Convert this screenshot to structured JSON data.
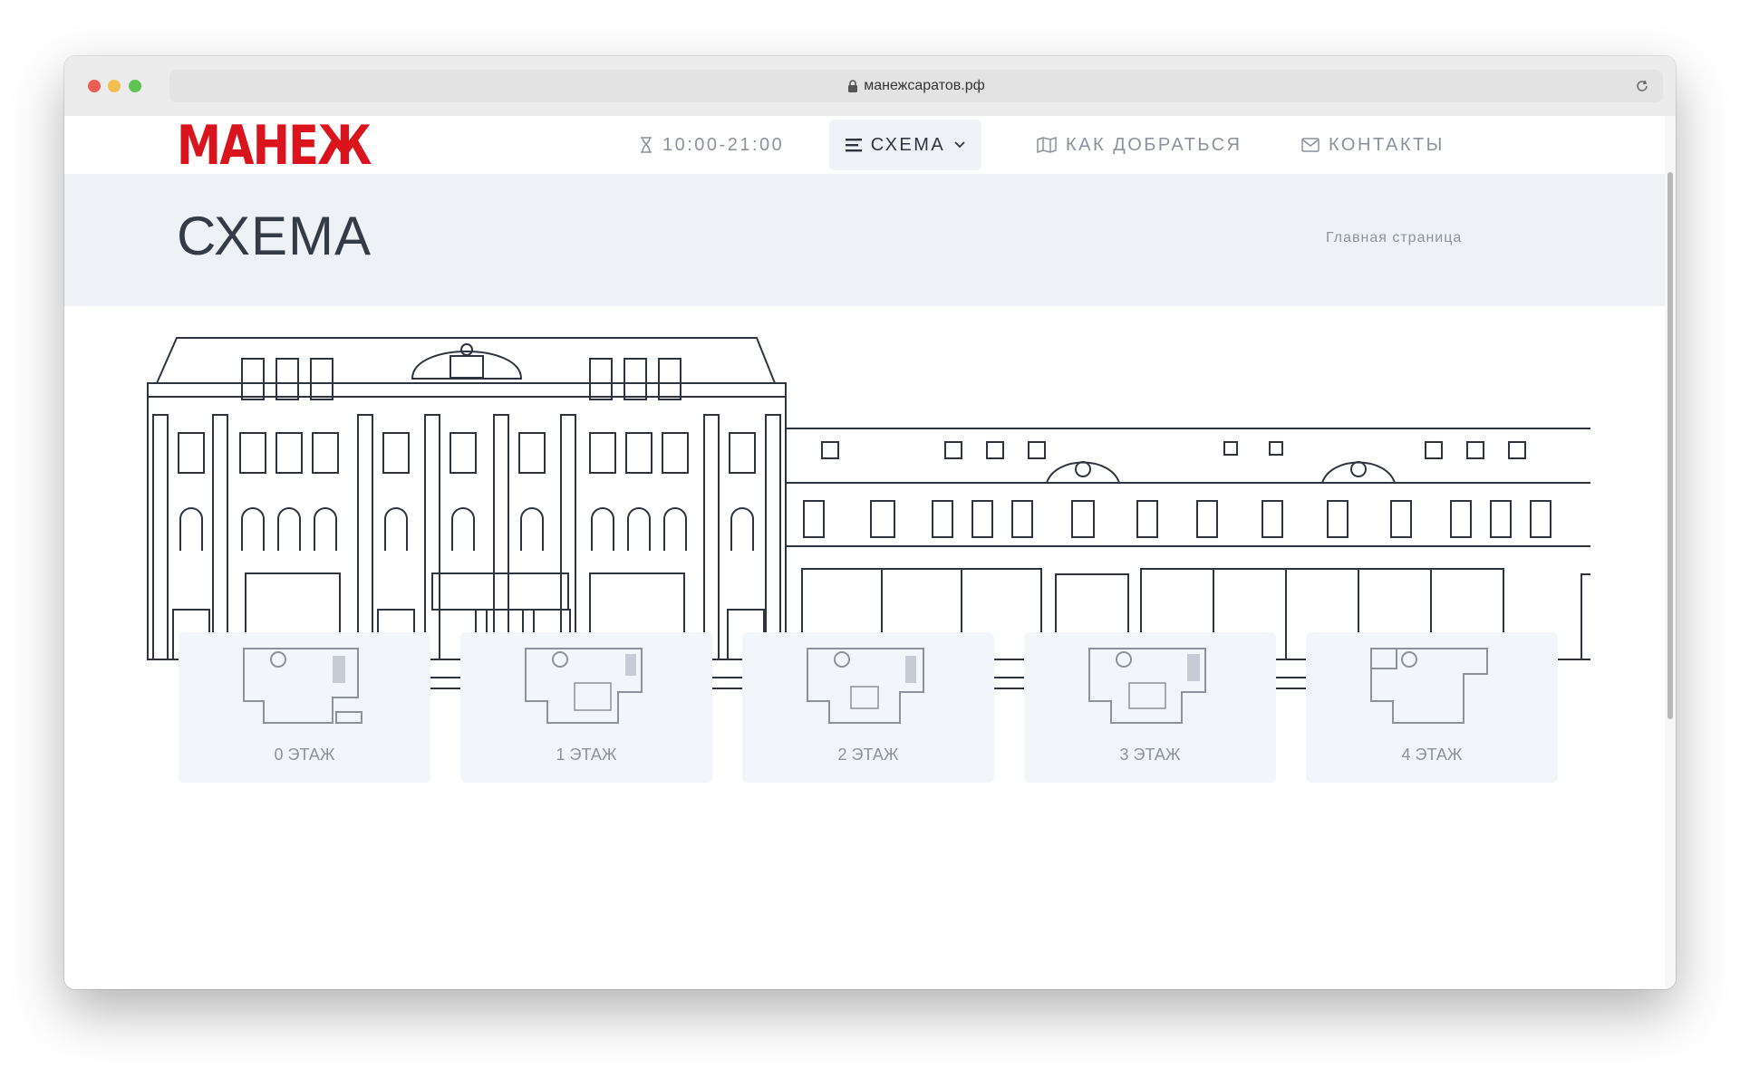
{
  "browser": {
    "url": "манежсаратов.рф",
    "icons": [
      "lock-icon",
      "reload-icon"
    ]
  },
  "nav": {
    "logo": "МАНЕЖ",
    "hours": "10:00-21:00",
    "schema": "СХЕМА",
    "directions": "КАК ДОБРАТЬСЯ",
    "contacts": "КОНТАКТЫ",
    "icons": [
      "hourglass-icon",
      "menu-icon",
      "chevron-down-icon",
      "map-icon",
      "mail-icon"
    ]
  },
  "header": {
    "title": "СХЕМА",
    "breadcrumb": "Главная страница"
  },
  "floors": [
    {
      "label": "0 ЭТАЖ"
    },
    {
      "label": "1 ЭТАЖ"
    },
    {
      "label": "2 ЭТАЖ"
    },
    {
      "label": "3 ЭТАЖ"
    },
    {
      "label": "4 ЭТАЖ"
    }
  ],
  "colors": {
    "brand": "#d9141c",
    "band": "#eef2f7",
    "text": "#333b46",
    "muted": "#8b929c"
  }
}
